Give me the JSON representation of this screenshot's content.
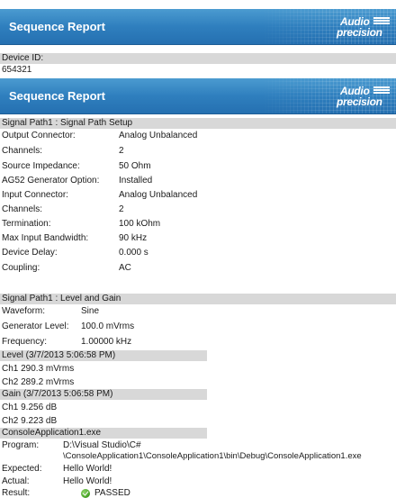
{
  "banner": {
    "title": "Sequence Report",
    "logo_line1": "Audio",
    "logo_line2": "precision"
  },
  "device": {
    "label": "Device ID:",
    "value": "654321"
  },
  "banner2": {
    "title": "Sequence Report",
    "logo_line1": "Audio",
    "logo_line2": "precision"
  },
  "setup": {
    "header": "Signal Path1 : Signal Path Setup",
    "rows": [
      {
        "label": "Output Connector:",
        "value": "Analog Unbalanced"
      },
      {
        "label": "Channels:",
        "value": "2"
      },
      {
        "label": "Source Impedance:",
        "value": "50 Ohm"
      },
      {
        "label": "AG52 Generator Option:",
        "value": "Installed"
      },
      {
        "label": "Input Connector:",
        "value": "Analog Unbalanced"
      },
      {
        "label": "Channels:",
        "value": "2"
      },
      {
        "label": "Termination:",
        "value": "100 kOhm"
      },
      {
        "label": "Max Input Bandwidth:",
        "value": "90 kHz"
      },
      {
        "label": "Device Delay:",
        "value": "0.000 s"
      },
      {
        "label": "Coupling:",
        "value": "AC"
      }
    ]
  },
  "level_gain": {
    "header": "Signal Path1 : Level and Gain",
    "rows": [
      {
        "label": "Waveform:",
        "value": "Sine"
      },
      {
        "label": "Generator Level:",
        "value": "100.0 mVrms"
      },
      {
        "label": "Frequency:",
        "value": "1.00000 kHz"
      }
    ]
  },
  "level": {
    "header": "Level (3/7/2013 5:06:58 PM)",
    "rows": [
      "Ch1 290.3 mVrms",
      "Ch2 289.2 mVrms"
    ]
  },
  "gain": {
    "header": "Gain (3/7/2013 5:06:58 PM)",
    "rows": [
      "Ch1 9.256 dB",
      "Ch2 9.223 dB"
    ]
  },
  "console": {
    "header": "ConsoleApplication1.exe",
    "program_label": "Program:",
    "program_line1": "D:\\Visual Studio\\C#",
    "program_line2": "\\ConsoleApplication1\\ConsoleApplication1\\bin\\Debug\\ConsoleApplication1.exe",
    "expected_label": "Expected:",
    "expected_value": "Hello World!",
    "actual_label": "Actual:",
    "actual_value": "Hello World!",
    "result_label": "Result:",
    "result_value": "PASSED",
    "result_icon": "check-circle-icon",
    "pass_color": "#4da82a"
  }
}
